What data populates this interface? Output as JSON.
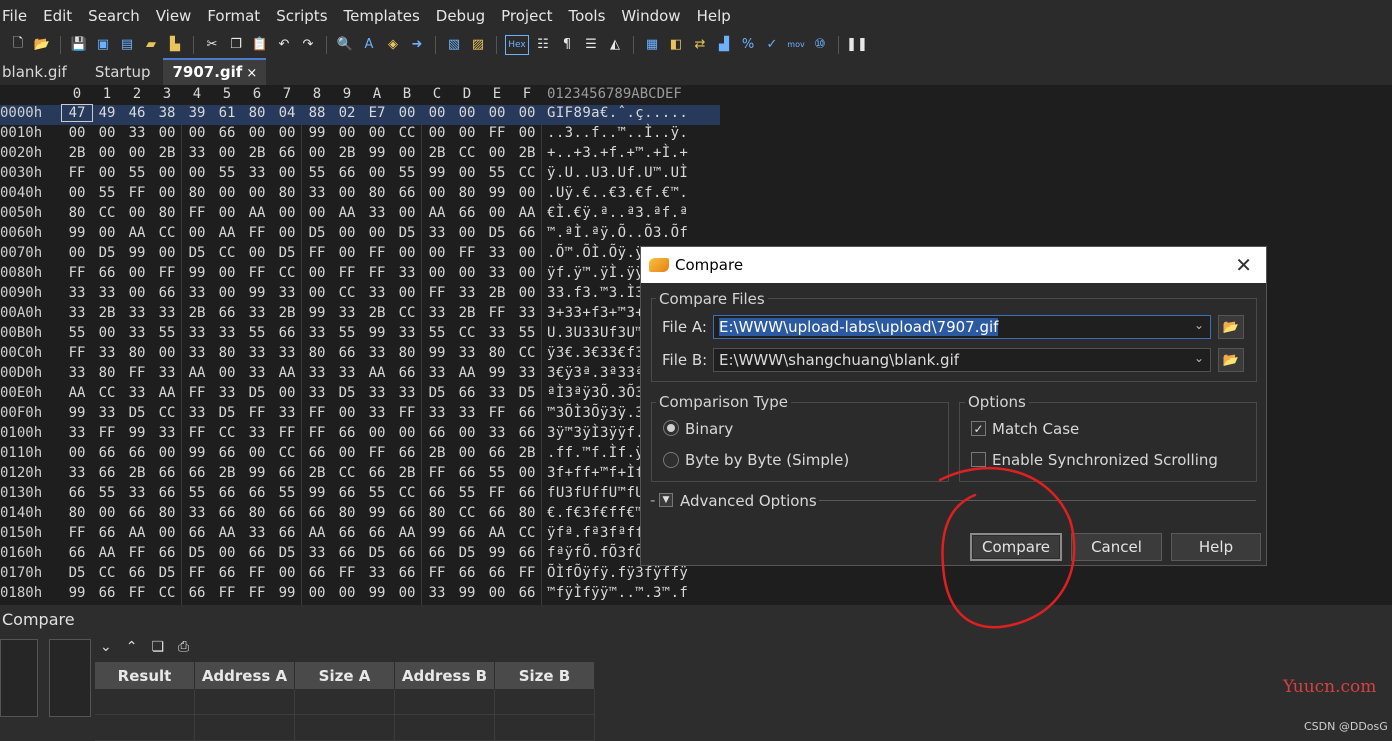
{
  "menu": [
    "File",
    "Edit",
    "Search",
    "View",
    "Format",
    "Scripts",
    "Templates",
    "Debug",
    "Project",
    "Tools",
    "Window",
    "Help"
  ],
  "tabs": [
    {
      "label": "blank.gif"
    },
    {
      "label": "Startup"
    },
    {
      "label": "7907.gif",
      "close": "×"
    }
  ],
  "hex": {
    "col_headers": [
      "0",
      "1",
      "2",
      "3",
      "4",
      "5",
      "6",
      "7",
      "8",
      "9",
      "A",
      "B",
      "C",
      "D",
      "E",
      "F"
    ],
    "ascii_header": "0123456789ABCDEF",
    "rows": [
      {
        "addr": "0000h",
        "bytes": [
          "47",
          "49",
          "46",
          "38",
          "39",
          "61",
          "80",
          "04",
          "88",
          "02",
          "E7",
          "00",
          "00",
          "00",
          "00",
          "00"
        ],
        "ascii": "GIF89a€.ˆ.ç....."
      },
      {
        "addr": "0010h",
        "bytes": [
          "00",
          "00",
          "33",
          "00",
          "00",
          "66",
          "00",
          "00",
          "99",
          "00",
          "00",
          "CC",
          "00",
          "00",
          "FF",
          "00"
        ],
        "ascii": "..3..f..™..Ì..ÿ."
      },
      {
        "addr": "0020h",
        "bytes": [
          "2B",
          "00",
          "00",
          "2B",
          "33",
          "00",
          "2B",
          "66",
          "00",
          "2B",
          "99",
          "00",
          "2B",
          "CC",
          "00",
          "2B"
        ],
        "ascii": "+..+3.+f.+™.+Ì.+"
      },
      {
        "addr": "0030h",
        "bytes": [
          "FF",
          "00",
          "55",
          "00",
          "00",
          "55",
          "33",
          "00",
          "55",
          "66",
          "00",
          "55",
          "99",
          "00",
          "55",
          "CC"
        ],
        "ascii": "ÿ.U..U3.Uf.U™.UÌ"
      },
      {
        "addr": "0040h",
        "bytes": [
          "00",
          "55",
          "FF",
          "00",
          "80",
          "00",
          "00",
          "80",
          "33",
          "00",
          "80",
          "66",
          "00",
          "80",
          "99",
          "00"
        ],
        "ascii": ".Uÿ.€..€3.€f.€™."
      },
      {
        "addr": "0050h",
        "bytes": [
          "80",
          "CC",
          "00",
          "80",
          "FF",
          "00",
          "AA",
          "00",
          "00",
          "AA",
          "33",
          "00",
          "AA",
          "66",
          "00",
          "AA"
        ],
        "ascii": "€Ì.€ÿ.ª..ª3.ªf.ª"
      },
      {
        "addr": "0060h",
        "bytes": [
          "99",
          "00",
          "AA",
          "CC",
          "00",
          "AA",
          "FF",
          "00",
          "D5",
          "00",
          "00",
          "D5",
          "33",
          "00",
          "D5",
          "66"
        ],
        "ascii": "™.ªÌ.ªÿ.Õ..Õ3.Õf"
      },
      {
        "addr": "0070h",
        "bytes": [
          "00",
          "D5",
          "99",
          "00",
          "D5",
          "CC",
          "00",
          "D5",
          "FF",
          "00",
          "FF",
          "00",
          "00",
          "FF",
          "33",
          "00"
        ],
        "ascii": ".Õ™.ÕÌ.Õÿ.ÿ..ÿ3."
      },
      {
        "addr": "0080h",
        "bytes": [
          "FF",
          "66",
          "00",
          "FF",
          "99",
          "00",
          "FF",
          "CC",
          "00",
          "FF",
          "FF",
          "33",
          "00",
          "00",
          "33",
          "00"
        ],
        "ascii": "ÿf.ÿ™.ÿÌ.ÿÿ3..3."
      },
      {
        "addr": "0090h",
        "bytes": [
          "33",
          "33",
          "00",
          "66",
          "33",
          "00",
          "99",
          "33",
          "00",
          "CC",
          "33",
          "00",
          "FF",
          "33",
          "2B",
          "00"
        ],
        "ascii": "33.f3.™3.Ì3.ÿ3+."
      },
      {
        "addr": "00A0h",
        "bytes": [
          "33",
          "2B",
          "33",
          "33",
          "2B",
          "66",
          "33",
          "2B",
          "99",
          "33",
          "2B",
          "CC",
          "33",
          "2B",
          "FF",
          "33"
        ],
        "ascii": "3+33+f3+™3+Ì3+ÿ3"
      },
      {
        "addr": "00B0h",
        "bytes": [
          "55",
          "00",
          "33",
          "55",
          "33",
          "33",
          "55",
          "66",
          "33",
          "55",
          "99",
          "33",
          "55",
          "CC",
          "33",
          "55"
        ],
        "ascii": "U.3U33Uf3U™3UÌ3U"
      },
      {
        "addr": "00C0h",
        "bytes": [
          "FF",
          "33",
          "80",
          "00",
          "33",
          "80",
          "33",
          "33",
          "80",
          "66",
          "33",
          "80",
          "99",
          "33",
          "80",
          "CC"
        ],
        "ascii": "ÿ3€.3€33€f3€™3€Ì"
      },
      {
        "addr": "00D0h",
        "bytes": [
          "33",
          "80",
          "FF",
          "33",
          "AA",
          "00",
          "33",
          "AA",
          "33",
          "33",
          "AA",
          "66",
          "33",
          "AA",
          "99",
          "33"
        ],
        "ascii": "3€ÿ3ª.3ª33ªf3ª™3"
      },
      {
        "addr": "00E0h",
        "bytes": [
          "AA",
          "CC",
          "33",
          "AA",
          "FF",
          "33",
          "D5",
          "00",
          "33",
          "D5",
          "33",
          "33",
          "D5",
          "66",
          "33",
          "D5"
        ],
        "ascii": "ªÌ3ªÿ3Õ.3Õ33Õf3Õ"
      },
      {
        "addr": "00F0h",
        "bytes": [
          "99",
          "33",
          "D5",
          "CC",
          "33",
          "D5",
          "FF",
          "33",
          "FF",
          "00",
          "33",
          "FF",
          "33",
          "33",
          "FF",
          "66"
        ],
        "ascii": "™3ÕÌ3Õÿ3ÿ.3ÿ33ÿf"
      },
      {
        "addr": "0100h",
        "bytes": [
          "33",
          "FF",
          "99",
          "33",
          "FF",
          "CC",
          "33",
          "FF",
          "FF",
          "66",
          "00",
          "00",
          "66",
          "00",
          "33",
          "66"
        ],
        "ascii": "3ÿ™3ÿÌ3ÿÿf..f.3f"
      },
      {
        "addr": "0110h",
        "bytes": [
          "00",
          "66",
          "66",
          "00",
          "99",
          "66",
          "00",
          "CC",
          "66",
          "00",
          "FF",
          "66",
          "2B",
          "00",
          "66",
          "2B"
        ],
        "ascii": ".ff.™f.Ìf.ÿf+.f+"
      },
      {
        "addr": "0120h",
        "bytes": [
          "33",
          "66",
          "2B",
          "66",
          "66",
          "2B",
          "99",
          "66",
          "2B",
          "CC",
          "66",
          "2B",
          "FF",
          "66",
          "55",
          "00"
        ],
        "ascii": "3f+ff+™f+Ìf+ÿfU."
      },
      {
        "addr": "0130h",
        "bytes": [
          "66",
          "55",
          "33",
          "66",
          "55",
          "66",
          "66",
          "55",
          "99",
          "66",
          "55",
          "CC",
          "66",
          "55",
          "FF",
          "66"
        ],
        "ascii": "fU3fUffU™fUÌfUÿf"
      },
      {
        "addr": "0140h",
        "bytes": [
          "80",
          "00",
          "66",
          "80",
          "33",
          "66",
          "80",
          "66",
          "66",
          "80",
          "99",
          "66",
          "80",
          "CC",
          "66",
          "80"
        ],
        "ascii": "€.f€3f€ff€™f€Ìf€"
      },
      {
        "addr": "0150h",
        "bytes": [
          "FF",
          "66",
          "AA",
          "00",
          "66",
          "AA",
          "33",
          "66",
          "AA",
          "66",
          "66",
          "AA",
          "99",
          "66",
          "AA",
          "CC"
        ],
        "ascii": "ÿfª.fª3fªffª™fªÌ"
      },
      {
        "addr": "0160h",
        "bytes": [
          "66",
          "AA",
          "FF",
          "66",
          "D5",
          "00",
          "66",
          "D5",
          "33",
          "66",
          "D5",
          "66",
          "66",
          "D5",
          "99",
          "66"
        ],
        "ascii": "fªÿfÕ.fÕ3fÕffÕ™f"
      },
      {
        "addr": "0170h",
        "bytes": [
          "D5",
          "CC",
          "66",
          "D5",
          "FF",
          "66",
          "FF",
          "00",
          "66",
          "FF",
          "33",
          "66",
          "FF",
          "66",
          "66",
          "FF"
        ],
        "ascii": "ÕÌfÕÿfÿ.fÿ3fÿffÿ"
      },
      {
        "addr": "0180h",
        "bytes": [
          "99",
          "66",
          "FF",
          "CC",
          "66",
          "FF",
          "FF",
          "99",
          "00",
          "00",
          "99",
          "00",
          "33",
          "99",
          "00",
          "66"
        ],
        "ascii": "™fÿÌfÿÿ™..™.3™.f"
      }
    ]
  },
  "compare_panel": {
    "title": "Compare",
    "columns": [
      "Result",
      "Address A",
      "Size A",
      "Address B",
      "Size B"
    ]
  },
  "dialog": {
    "title": "Compare",
    "close": "✕",
    "compare_files_label": "Compare Files",
    "file_a_label": "File A:",
    "file_a_value": "E:\\WWW\\upload-labs\\upload\\7907.gif",
    "file_b_label": "File B:",
    "file_b_value": "E:\\WWW\\shangchuang\\blank.gif",
    "comparison_type_label": "Comparison Type",
    "binary_label": "Binary",
    "byte_by_byte_label": "Byte by Byte (Simple)",
    "options_label": "Options",
    "match_case_label": "Match Case",
    "sync_scroll_label": "Enable Synchronized Scrolling",
    "advanced_label": "Advanced Options",
    "compare_button": "Compare",
    "cancel_button": "Cancel",
    "help_button": "Help",
    "binary_selected": true,
    "match_case_checked": true,
    "sync_scroll_checked": false
  },
  "watermark": {
    "site": "Yuucn.com",
    "csdn": "CSDN @DDosG"
  },
  "colors": {
    "accent_blue": "#2c5aa0",
    "annotation_red": "#e02020"
  }
}
